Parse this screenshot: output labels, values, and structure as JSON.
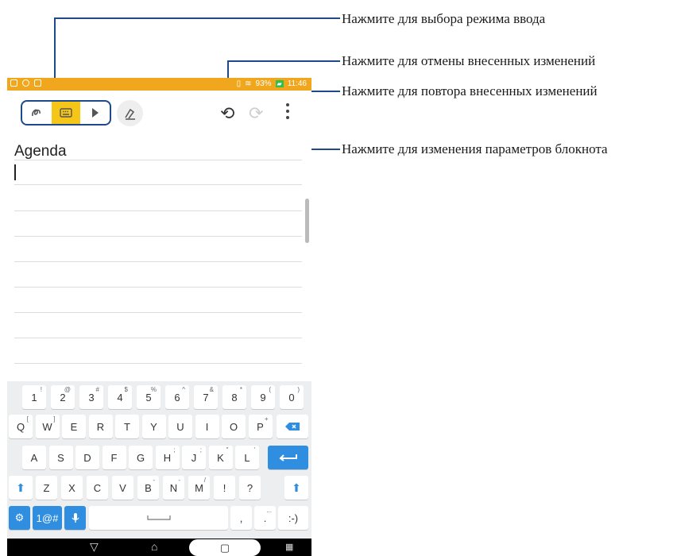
{
  "callouts": {
    "input_mode": "Нажмите для выбора режима ввода",
    "undo": "Нажмите для отмены внесенных изменений",
    "redo": "Нажмите для повтора внесенных изменений",
    "settings": "Нажмите для изменения параметров блокнота"
  },
  "status_bar": {
    "battery": "93%",
    "time": "11:46",
    "color": "#f0a71e"
  },
  "toolbar": {
    "mode_icons": [
      "handwriting-mode-icon",
      "keyboard-mode-icon",
      "pen-mode-icon"
    ],
    "active_mode": "keyboard",
    "pen_color_icon": "pen-color-icon",
    "undo_icon": "undo-icon",
    "redo_icon": "redo-icon",
    "more_icon": "more-vertical-icon"
  },
  "note": {
    "title": "Agenda"
  },
  "keyboard": {
    "row1": [
      {
        "k": "1",
        "s": "!"
      },
      {
        "k": "2",
        "s": "@"
      },
      {
        "k": "3",
        "s": "#"
      },
      {
        "k": "4",
        "s": "$"
      },
      {
        "k": "5",
        "s": "%"
      },
      {
        "k": "6",
        "s": "^"
      },
      {
        "k": "7",
        "s": "&"
      },
      {
        "k": "8",
        "s": "*"
      },
      {
        "k": "9",
        "s": "("
      },
      {
        "k": "0",
        "s": ")"
      }
    ],
    "row2": [
      {
        "k": "Q",
        "s": "["
      },
      {
        "k": "W",
        "s": "]"
      },
      {
        "k": "E",
        "s": ""
      },
      {
        "k": "R",
        "s": ""
      },
      {
        "k": "T",
        "s": ""
      },
      {
        "k": "Y",
        "s": ""
      },
      {
        "k": "U",
        "s": ""
      },
      {
        "k": "I",
        "s": ""
      },
      {
        "k": "O",
        "s": ""
      },
      {
        "k": "P",
        "s": "+"
      }
    ],
    "row3": [
      {
        "k": "A",
        "s": ""
      },
      {
        "k": "S",
        "s": ""
      },
      {
        "k": "D",
        "s": ""
      },
      {
        "k": "F",
        "s": ""
      },
      {
        "k": "G",
        "s": ""
      },
      {
        "k": "H",
        "s": ";"
      },
      {
        "k": "J",
        "s": ";"
      },
      {
        "k": "K",
        "s": "\""
      },
      {
        "k": "L",
        "s": "'"
      }
    ],
    "row4": [
      {
        "k": "Z",
        "s": ""
      },
      {
        "k": "X",
        "s": ""
      },
      {
        "k": "C",
        "s": ""
      },
      {
        "k": "V",
        "s": ""
      },
      {
        "k": "B",
        "s": "-"
      },
      {
        "k": "N",
        "s": "-"
      },
      {
        "k": "M",
        "s": "/"
      },
      {
        "k": "!",
        "s": ""
      },
      {
        "k": "?",
        "s": ""
      }
    ],
    "symbols_label": "1@#",
    "comma": ",",
    "period": ".",
    "period_alt": "...",
    "smiley": ":-)",
    "accent_color": "#2f8ee0"
  }
}
